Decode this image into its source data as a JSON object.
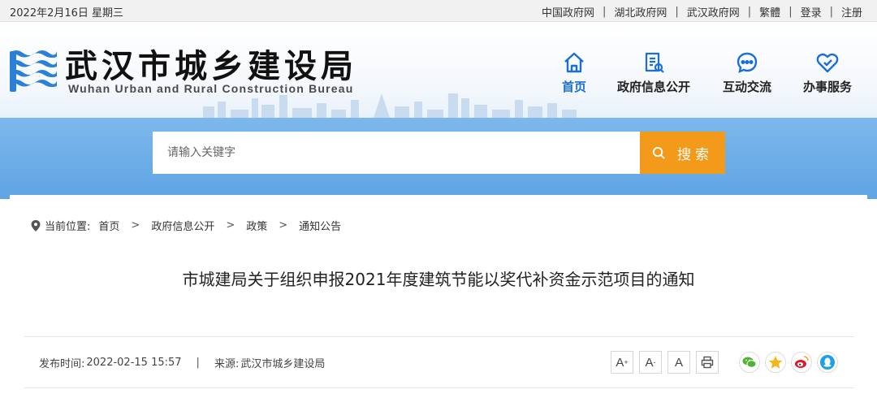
{
  "topbar": {
    "date": "2022年2月16日 星期三",
    "links": [
      {
        "label": "中国政府网"
      },
      {
        "label": "湖北政府网"
      },
      {
        "label": "武汉政府网"
      },
      {
        "label": "繁體"
      },
      {
        "label": "登录"
      },
      {
        "label": "注册"
      }
    ]
  },
  "header": {
    "title": "武汉市城乡建设局",
    "subtitle": "Wuhan Urban and Rural Construction Bureau",
    "nav": [
      {
        "label": "首页",
        "icon": "home-icon",
        "active": true
      },
      {
        "label": "政府信息公开",
        "icon": "document-icon",
        "active": false
      },
      {
        "label": "互动交流",
        "icon": "chat-icon",
        "active": false
      },
      {
        "label": "办事服务",
        "icon": "heart-check-icon",
        "active": false
      }
    ]
  },
  "search": {
    "placeholder": "请输入关键字",
    "button_label": "搜索"
  },
  "breadcrumb": {
    "prefix": "当前位置:",
    "items": [
      "首页",
      "政府信息公开",
      "政策",
      "通知公告"
    ]
  },
  "article": {
    "title": "市城建局关于组织申报2021年度建筑节能以奖代补资金示范项目的通知",
    "publish_label": "发布时间:",
    "publish_time": "2022-02-15 15:57",
    "source_label": "来源:",
    "source": "武汉市城乡建设局"
  },
  "tools": {
    "font_a": "A",
    "plus": "+",
    "minus": "-"
  },
  "colors": {
    "accent": "#1a6ed8",
    "banner": "#6aaee8",
    "search_button": "#f39a1a"
  }
}
